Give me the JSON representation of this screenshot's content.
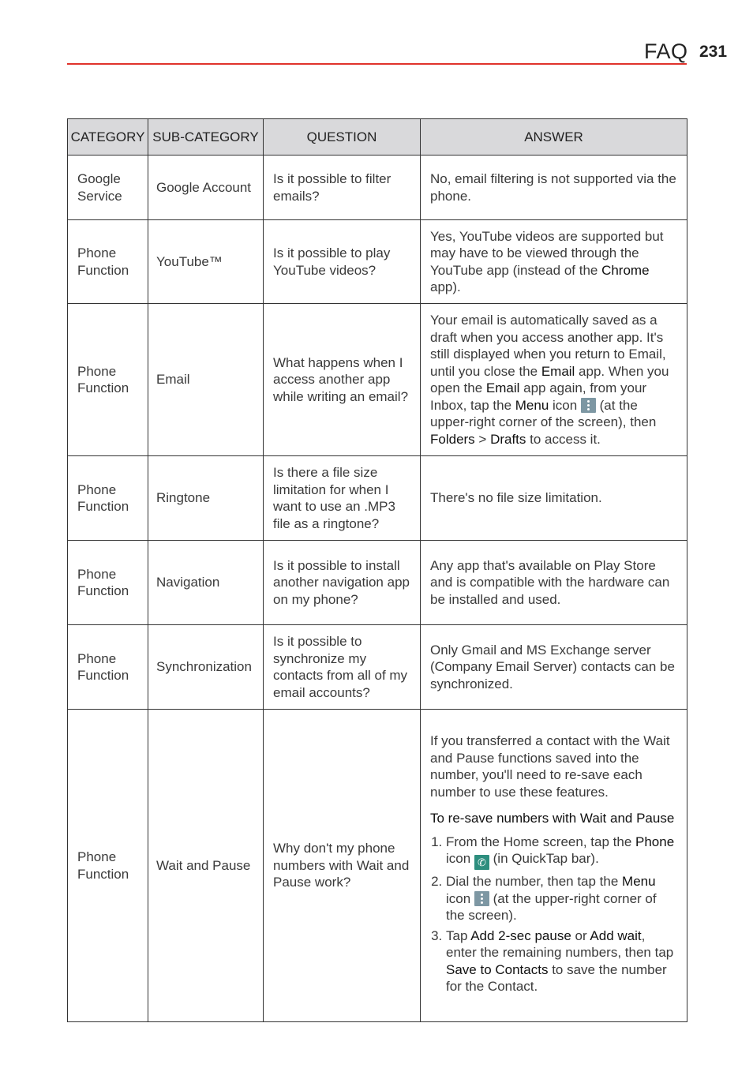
{
  "header": {
    "title": "FAQ",
    "page_number": "231"
  },
  "table": {
    "columns": [
      "CATEGORY",
      "SUB-CATEGORY",
      "QUESTION",
      "ANSWER"
    ],
    "rows": [
      {
        "category": "Google Service",
        "subcategory": "Google Account",
        "question": "Is it possible to filter emails?",
        "answer": {
          "text": "No, email filtering is not supported via the phone."
        }
      },
      {
        "category": "Phone Function",
        "subcategory": "YouTube™",
        "question": "Is it possible to play YouTube videos?",
        "answer": {
          "a": "Yes, YouTube videos are supported but may have to be viewed through the YouTube app (instead of the ",
          "b_chrome": "Chrome",
          "c": " app)."
        }
      },
      {
        "category": "Phone Function",
        "subcategory": "Email",
        "question": "What happens when I access another app while writing an email?",
        "answer": {
          "a": "Your email is automatically saved as a draft when you access another app. It's still displayed when you return to Email, until you close the ",
          "b_email1": "Email",
          "c": " app. When you open the ",
          "b_email2": "Email",
          "d": " app again, from your Inbox, tap the ",
          "b_menu": "Menu",
          "e": " icon ",
          "icon": "menu-icon",
          "f": " (at the upper-right corner of the screen), then ",
          "b_folders": "Folders",
          "g": " > ",
          "b_drafts": "Drafts",
          "h": " to access it."
        }
      },
      {
        "category": "Phone Function",
        "subcategory": "Ringtone",
        "question": "Is there a file size limitation for when I want to use an .MP3 file as a ringtone?",
        "answer": {
          "text": "There's no file size limitation."
        }
      },
      {
        "category": "Phone Function",
        "subcategory": "Navigation",
        "question": "Is it possible to install another navigation app on my phone?",
        "answer": {
          "text": "Any app that's available on Play Store and is compatible with the hardware can be installed and used."
        }
      },
      {
        "category": "Phone Function",
        "subcategory": "Synchronization",
        "question": "Is it possible to synchronize my contacts from all of my email accounts?",
        "answer": {
          "text": "Only Gmail and MS Exchange server (Company Email Server) contacts can be synchronized."
        }
      },
      {
        "category": "Phone Function",
        "subcategory": "Wait and Pause",
        "question": "Why don't my phone numbers with Wait and Pause work?",
        "answer": {
          "intro": "If you transferred a contact with the Wait and Pause functions saved into the number, you'll need to re-save each number to use these features.",
          "subheading": "To re-save numbers with Wait and Pause",
          "step1": {
            "a": "From the Home screen, tap the ",
            "b_phone": "Phone",
            "c": " icon ",
            "icon": "phone-icon",
            "d": " (in QuickTap bar)."
          },
          "step2": {
            "a": "Dial the number, then tap the ",
            "b_menu": "Menu",
            "c": " icon ",
            "icon": "menu-icon",
            "d": " (at the upper-right corner of the screen)."
          },
          "step3": {
            "a": "Tap ",
            "b_pause": "Add 2-sec pause",
            "c": " or ",
            "b_wait": "Add wait",
            "d": ", enter the remaining numbers, then tap ",
            "b_save": "Save to Contacts",
            "e": " to save the number for the Contact."
          }
        }
      }
    ]
  },
  "colors": {
    "accent_line": "#e0332b",
    "header_bg": "#d9d9db",
    "menu_icon": "#7d97a3",
    "phone_icon": "#2d8e7e"
  }
}
